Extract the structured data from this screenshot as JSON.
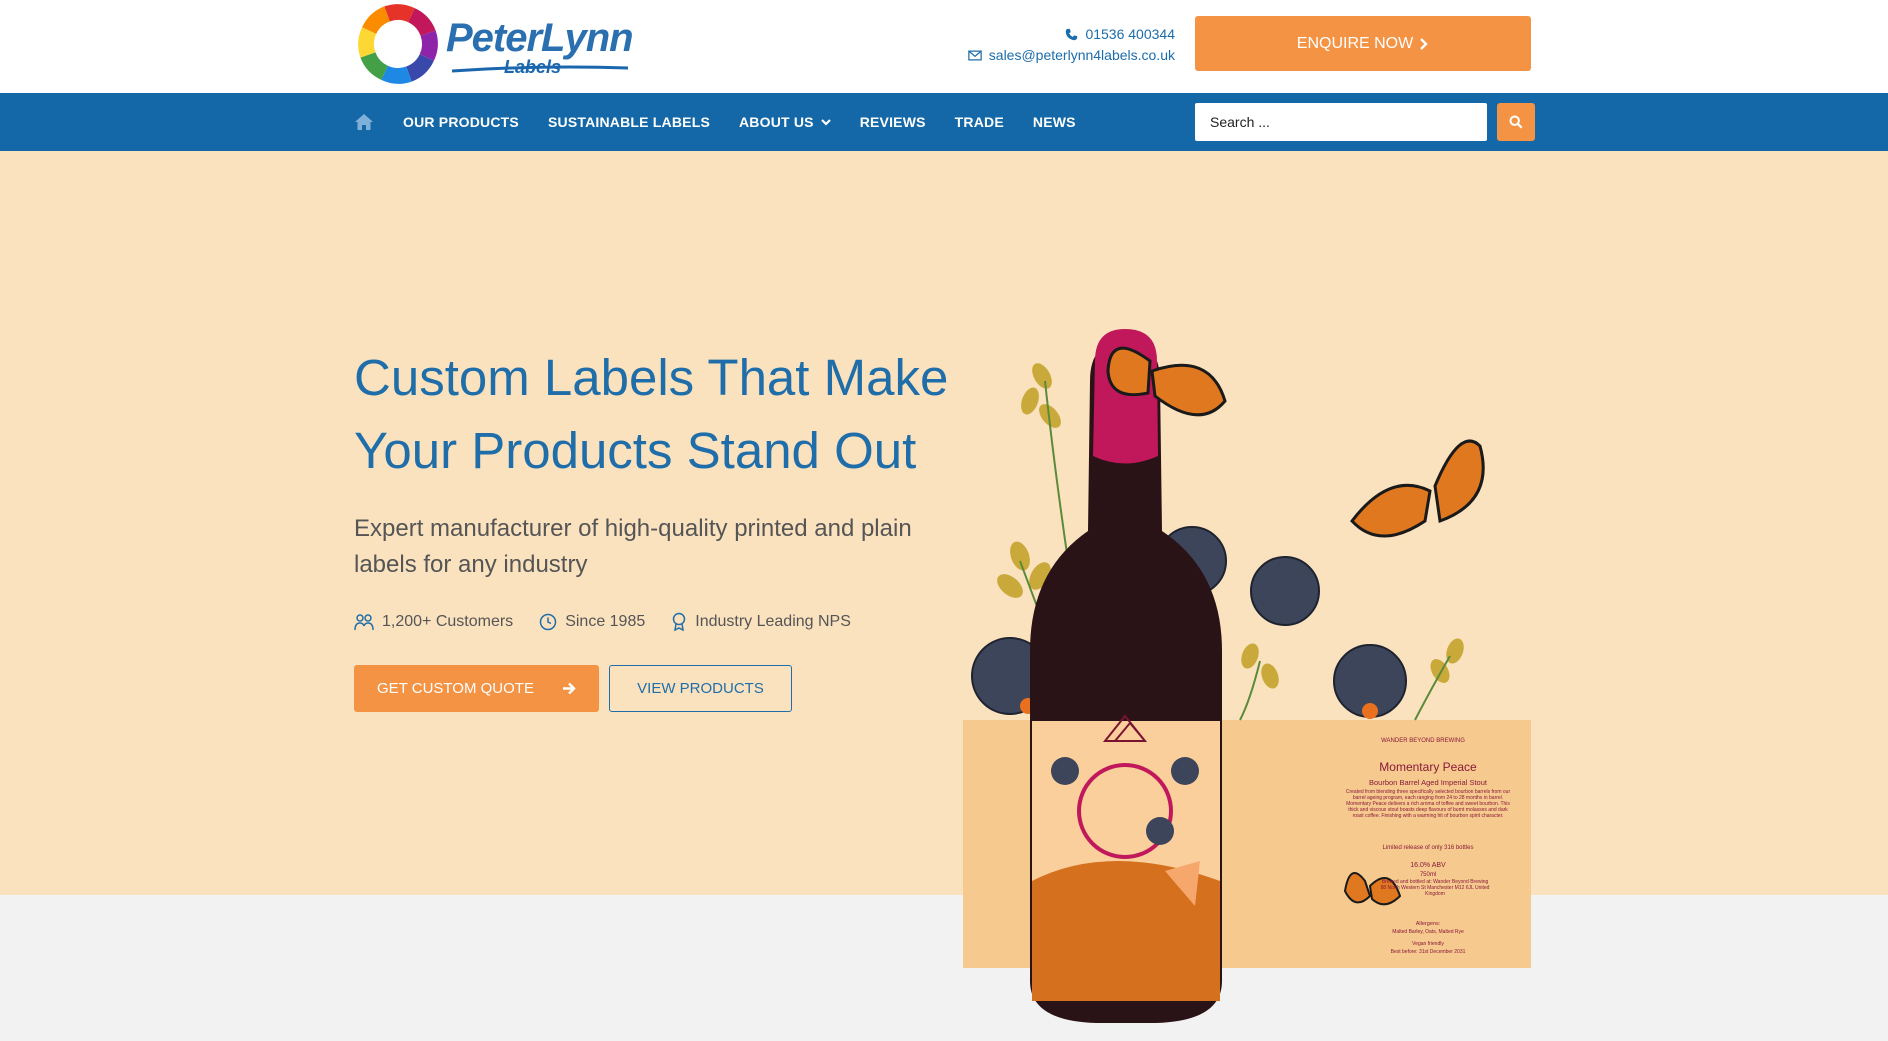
{
  "header": {
    "logo": {
      "text_main": "PeterLynn",
      "text_sub": "Labels"
    },
    "phone": "01536 400344",
    "email": "sales@peterlynn4labels.co.uk",
    "enquire_label": "ENQUIRE NOW",
    "colors": {
      "accent": "#f39343",
      "brand_blue": "#1468a7"
    }
  },
  "nav": {
    "home_icon": "home-icon",
    "items": [
      {
        "label": "OUR PRODUCTS"
      },
      {
        "label": "SUSTAINABLE LABELS"
      },
      {
        "label": "ABOUT US"
      },
      {
        "label": "REVIEWS"
      },
      {
        "label": "TRADE"
      },
      {
        "label": "NEWS"
      }
    ],
    "search": {
      "placeholder": "Search ..."
    }
  },
  "hero": {
    "headline_line1": "Custom Labels That Make",
    "headline_line2": "Your Products Stand Out",
    "subhead": "Expert manufacturer of high-quality printed and plain labels for any industry",
    "stats": [
      {
        "icon": "people-icon",
        "label": "1,200+ Customers"
      },
      {
        "icon": "clock-icon",
        "label": "Since 1985"
      },
      {
        "icon": "award-icon",
        "label": "Industry Leading NPS"
      }
    ],
    "quote_button": "GET CUSTOM QUOTE",
    "products_button": "VIEW PRODUCTS",
    "background": "#fbe2bf"
  },
  "label_art": {
    "brand": "WANDER BEYOND BREWING",
    "product_name": "Momentary Peace",
    "product_type": "Bourbon Barrel Aged Imperial Stout",
    "description": "Created from blending three specifically selected bourbon barrels from our barrel ageing program, each ranging from 24 to 28 months in barrel. Momentary Peace delivers a rich aroma of toffee and sweet bourbon. This thick and viscous stout boasts deep flavours of burnt molasses and dark roast coffee. Finishing with a warming hit of bourbon spirit character.",
    "limited": "Limited release of only 316 bottles",
    "abv": "16.0% ABV",
    "volume": "750ml",
    "brewed_by": "Brewed and bottled at: Wander Beyond Brewing 98 North Western St Manchester M12 6JL United Kingdom",
    "allergens_title": "Allergens:",
    "allergens": "Malted Barley, Oats, Malted Rye",
    "vegan": "Vegan friendly",
    "best_before": "Best before: 31st December 2031"
  }
}
